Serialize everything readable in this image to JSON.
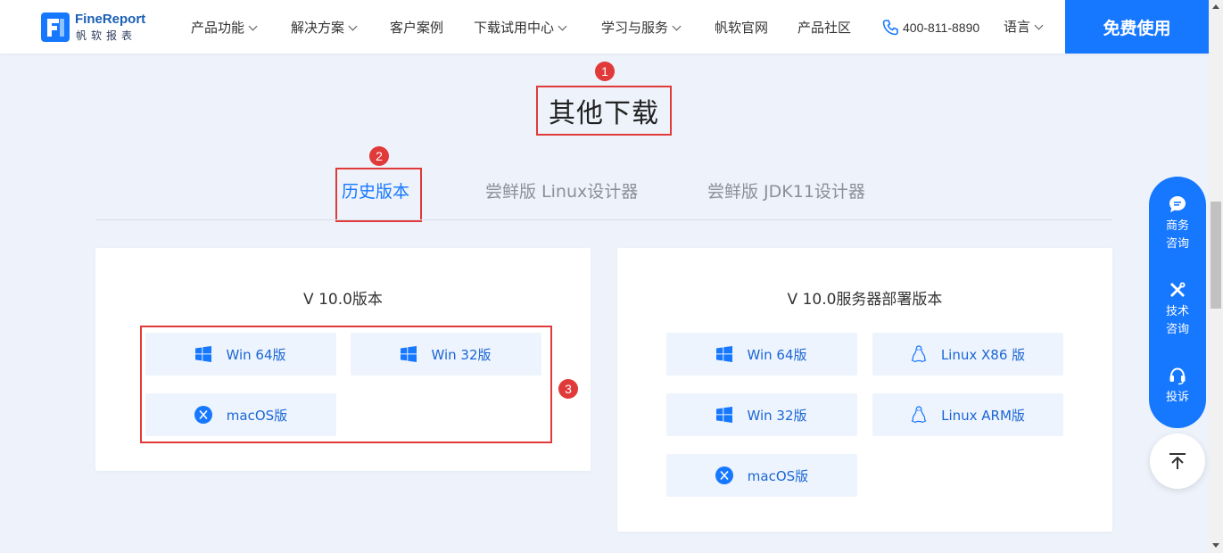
{
  "header": {
    "logo_name": "FineReport",
    "logo_sub": "帆软报表",
    "nav": [
      {
        "label": "产品功能",
        "has_dropdown": true
      },
      {
        "label": "解决方案",
        "has_dropdown": true
      },
      {
        "label": "客户案例",
        "has_dropdown": false
      },
      {
        "label": "下载试用中心",
        "has_dropdown": true
      },
      {
        "label": "学习与服务",
        "has_dropdown": true
      },
      {
        "label": "帆软官网",
        "has_dropdown": false
      },
      {
        "label": "产品社区",
        "has_dropdown": false
      }
    ],
    "phone": "400-811-8890",
    "language": "语言",
    "cta": "免费使用"
  },
  "page": {
    "title": "其他下载",
    "tabs": [
      "历史版本",
      "尝鲜版 Linux设计器",
      "尝鲜版 JDK11设计器"
    ],
    "active_tab": 0
  },
  "annotations": [
    "1",
    "2",
    "3"
  ],
  "cards": [
    {
      "title": "V 10.0版本",
      "buttons": [
        {
          "label": "Win 64版",
          "icon": "windows-icon"
        },
        {
          "label": "Win 32版",
          "icon": "windows-icon"
        },
        {
          "label": "macOS版",
          "icon": "macos-icon"
        }
      ]
    },
    {
      "title": "V 10.0服务器部署版本",
      "buttons": [
        {
          "label": "Win 64版",
          "icon": "windows-icon"
        },
        {
          "label": "Linux X86 版",
          "icon": "linux-icon"
        },
        {
          "label": "Win 32版",
          "icon": "windows-icon"
        },
        {
          "label": "Linux ARM版",
          "icon": "linux-icon"
        },
        {
          "label": "macOS版",
          "icon": "macos-icon"
        }
      ]
    }
  ],
  "float_bar": {
    "items": [
      {
        "label1": "商务",
        "label2": "咨询",
        "icon": "chat-icon"
      },
      {
        "label1": "技术",
        "label2": "咨询",
        "icon": "tools-icon"
      },
      {
        "label1": "投诉",
        "label2": "",
        "icon": "headset-icon"
      }
    ]
  },
  "colors": {
    "accent": "#1677ff",
    "background": "#eef3fb",
    "annotation_red": "#e03a3a",
    "button_bg": "#eef4fd"
  }
}
